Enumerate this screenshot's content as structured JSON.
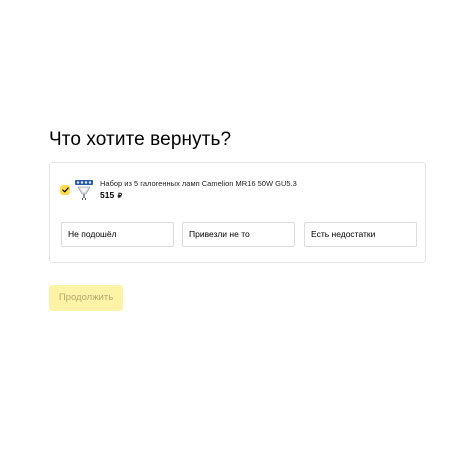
{
  "page": {
    "title": "Что хотите вернуть?"
  },
  "item": {
    "selected": true,
    "thumbnail_icon": "lamp-pack-icon",
    "name": "Набор из 5 галогенных ламп Camelion MR16 50W GU5.3",
    "price": "515",
    "currency": "₽"
  },
  "reasons": [
    {
      "label": "Не подошёл"
    },
    {
      "label": "Привезли не то"
    },
    {
      "label": "Есть недостатки"
    }
  ],
  "continue_button": {
    "label": "Продолжить",
    "enabled": false
  },
  "colors": {
    "accent": "#ffdb4d",
    "button_disabled_bg": "#fff3a8",
    "button_disabled_text": "#b5a76a",
    "border": "#e6e6e6"
  }
}
